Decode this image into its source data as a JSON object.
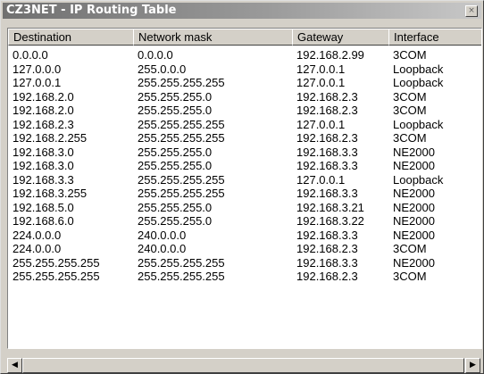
{
  "window": {
    "title": "CZ3NET - IP Routing Table",
    "close_glyph": "×"
  },
  "table": {
    "columns": [
      "Destination",
      "Network mask",
      "Gateway",
      "Interface"
    ],
    "rows": [
      [
        "0.0.0.0",
        "0.0.0.0",
        "192.168.2.99",
        "3COM"
      ],
      [
        "127.0.0.0",
        "255.0.0.0",
        "127.0.0.1",
        "Loopback"
      ],
      [
        "127.0.0.1",
        "255.255.255.255",
        "127.0.0.1",
        "Loopback"
      ],
      [
        "192.168.2.0",
        "255.255.255.0",
        "192.168.2.3",
        "3COM"
      ],
      [
        "192.168.2.0",
        "255.255.255.0",
        "192.168.2.3",
        "3COM"
      ],
      [
        "192.168.2.3",
        "255.255.255.255",
        "127.0.0.1",
        "Loopback"
      ],
      [
        "192.168.2.255",
        "255.255.255.255",
        "192.168.2.3",
        "3COM"
      ],
      [
        "192.168.3.0",
        "255.255.255.0",
        "192.168.3.3",
        "NE2000"
      ],
      [
        "192.168.3.0",
        "255.255.255.0",
        "192.168.3.3",
        "NE2000"
      ],
      [
        "192.168.3.3",
        "255.255.255.255",
        "127.0.0.1",
        "Loopback"
      ],
      [
        "192.168.3.255",
        "255.255.255.255",
        "192.168.3.3",
        "NE2000"
      ],
      [
        "192.168.5.0",
        "255.255.255.0",
        "192.168.3.21",
        "NE2000"
      ],
      [
        "192.168.6.0",
        "255.255.255.0",
        "192.168.3.22",
        "NE2000"
      ],
      [
        "224.0.0.0",
        "240.0.0.0",
        "192.168.3.3",
        "NE2000"
      ],
      [
        "224.0.0.0",
        "240.0.0.0",
        "192.168.2.3",
        "3COM"
      ],
      [
        "255.255.255.255",
        "255.255.255.255",
        "192.168.3.3",
        "NE2000"
      ],
      [
        "255.255.255.255",
        "255.255.255.255",
        "192.168.2.3",
        "3COM"
      ]
    ]
  },
  "scrollbar": {
    "left_glyph": "◀",
    "right_glyph": "▶"
  }
}
